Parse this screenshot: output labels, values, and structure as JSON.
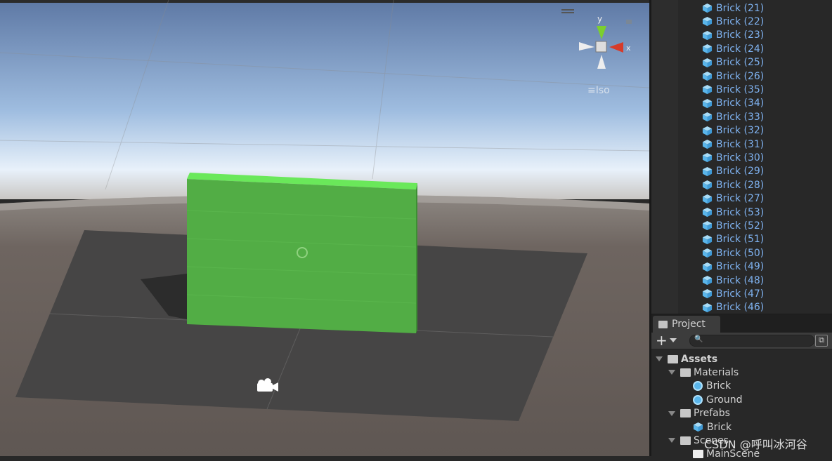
{
  "scene": {
    "gizmo": {
      "y_label": "y",
      "x_label": "x",
      "projection": "Iso"
    },
    "colors": {
      "brick": "#55b347",
      "sky": "#6a86b0",
      "ground": "#6b625c",
      "plane": "#454545"
    }
  },
  "hierarchy": {
    "items": [
      "Brick (21)",
      "Brick (22)",
      "Brick (23)",
      "Brick (24)",
      "Brick (25)",
      "Brick (26)",
      "Brick (35)",
      "Brick (34)",
      "Brick (33)",
      "Brick (32)",
      "Brick (31)",
      "Brick (30)",
      "Brick (29)",
      "Brick (28)",
      "Brick (27)",
      "Brick (53)",
      "Brick (52)",
      "Brick (51)",
      "Brick (50)",
      "Brick (49)",
      "Brick (48)",
      "Brick (47)",
      "Brick (46)"
    ]
  },
  "project": {
    "tab": "Project",
    "search_placeholder": "",
    "tree": [
      {
        "label": "Assets",
        "depth": 0,
        "type": "folder",
        "expanded": true,
        "bold": true
      },
      {
        "label": "Materials",
        "depth": 1,
        "type": "folder",
        "expanded": true
      },
      {
        "label": "Brick",
        "depth": 2,
        "type": "material"
      },
      {
        "label": "Ground",
        "depth": 2,
        "type": "material"
      },
      {
        "label": "Prefabs",
        "depth": 1,
        "type": "folder",
        "expanded": true
      },
      {
        "label": "Brick",
        "depth": 2,
        "type": "prefab"
      },
      {
        "label": "Scenes",
        "depth": 1,
        "type": "folder",
        "expanded": true
      },
      {
        "label": "MainScene",
        "depth": 2,
        "type": "scene"
      }
    ]
  },
  "watermark": "CSDN @呼叫冰河谷"
}
